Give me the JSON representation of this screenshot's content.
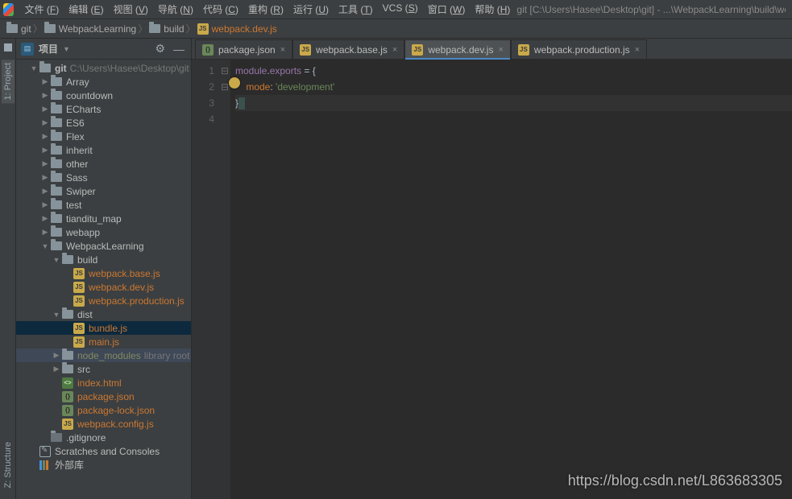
{
  "menu": {
    "items": [
      {
        "label": "文件",
        "u": "F"
      },
      {
        "label": "编辑",
        "u": "E"
      },
      {
        "label": "视图",
        "u": "V"
      },
      {
        "label": "导航",
        "u": "N"
      },
      {
        "label": "代码",
        "u": "C"
      },
      {
        "label": "重构",
        "u": "R"
      },
      {
        "label": "运行",
        "u": "U"
      },
      {
        "label": "工具",
        "u": "T"
      },
      {
        "label": "VCS",
        "u": "S"
      },
      {
        "label": "窗口",
        "u": "W"
      },
      {
        "label": "帮助",
        "u": "H"
      }
    ],
    "title": "git [C:\\Users\\Hasee\\Desktop\\git] - ...\\WebpackLearning\\build\\webpack.dev.js - W"
  },
  "breadcrumb": [
    {
      "type": "folder",
      "label": "git"
    },
    {
      "type": "folder",
      "label": "WebpackLearning"
    },
    {
      "type": "folder",
      "label": "build"
    },
    {
      "type": "js",
      "label": "webpack.dev.js",
      "orange": true
    }
  ],
  "left_tabs": {
    "project": "1: Project",
    "structure": "Z: Structure"
  },
  "tool": {
    "title": "项目",
    "gear_icon": "⚙",
    "min_icon": "—"
  },
  "tree": [
    {
      "depth": 0,
      "arrow": "open",
      "ico": "folder",
      "name": "git",
      "hint": "C:\\Users\\Hasee\\Desktop\\git",
      "bold": true
    },
    {
      "depth": 1,
      "arrow": "closed",
      "ico": "folder",
      "name": "Array"
    },
    {
      "depth": 1,
      "arrow": "closed",
      "ico": "folder",
      "name": "countdown"
    },
    {
      "depth": 1,
      "arrow": "closed",
      "ico": "folder",
      "name": "ECharts"
    },
    {
      "depth": 1,
      "arrow": "closed",
      "ico": "folder",
      "name": "ES6"
    },
    {
      "depth": 1,
      "arrow": "closed",
      "ico": "folder",
      "name": "Flex"
    },
    {
      "depth": 1,
      "arrow": "closed",
      "ico": "folder",
      "name": "inherit"
    },
    {
      "depth": 1,
      "arrow": "closed",
      "ico": "folder",
      "name": "other"
    },
    {
      "depth": 1,
      "arrow": "closed",
      "ico": "folder",
      "name": "Sass"
    },
    {
      "depth": 1,
      "arrow": "closed",
      "ico": "folder",
      "name": "Swiper"
    },
    {
      "depth": 1,
      "arrow": "closed",
      "ico": "folder",
      "name": "test"
    },
    {
      "depth": 1,
      "arrow": "closed",
      "ico": "folder",
      "name": "tianditu_map"
    },
    {
      "depth": 1,
      "arrow": "closed",
      "ico": "folder",
      "name": "webapp"
    },
    {
      "depth": 1,
      "arrow": "open",
      "ico": "folder",
      "name": "WebpackLearning"
    },
    {
      "depth": 2,
      "arrow": "open",
      "ico": "folder",
      "name": "build"
    },
    {
      "depth": 3,
      "arrow": "none",
      "ico": "js",
      "name": "webpack.base.js",
      "orange": true
    },
    {
      "depth": 3,
      "arrow": "none",
      "ico": "js",
      "name": "webpack.dev.js",
      "orange": true
    },
    {
      "depth": 3,
      "arrow": "none",
      "ico": "js",
      "name": "webpack.production.js",
      "orange": true
    },
    {
      "depth": 2,
      "arrow": "open",
      "ico": "folder",
      "name": "dist"
    },
    {
      "depth": 3,
      "arrow": "none",
      "ico": "js",
      "name": "bundle.js",
      "orange": true,
      "sel": true
    },
    {
      "depth": 3,
      "arrow": "none",
      "ico": "js",
      "name": "main.js",
      "orange": true
    },
    {
      "depth": 2,
      "arrow": "closed",
      "ico": "folder",
      "name": "node_modules",
      "muted": true,
      "hint": "library root",
      "sel2": true
    },
    {
      "depth": 2,
      "arrow": "closed",
      "ico": "folder",
      "name": "src"
    },
    {
      "depth": 2,
      "arrow": "none",
      "ico": "html",
      "name": "index.html",
      "orange": true
    },
    {
      "depth": 2,
      "arrow": "none",
      "ico": "json",
      "name": "package.json",
      "orange": true
    },
    {
      "depth": 2,
      "arrow": "none",
      "ico": "json",
      "name": "package-lock.json",
      "orange": true
    },
    {
      "depth": 2,
      "arrow": "none",
      "ico": "js",
      "name": "webpack.config.js",
      "orange": true
    },
    {
      "depth": 1,
      "arrow": "none",
      "ico": "file",
      "name": ".gitignore"
    },
    {
      "depth": 0,
      "arrow": "none",
      "ico": "scratch",
      "name": "Scratches and Consoles"
    },
    {
      "depth": 0,
      "arrow": "none",
      "ico": "lib",
      "name": "外部库"
    }
  ],
  "tabs": [
    {
      "ico": "json",
      "label": "package.json",
      "active": false
    },
    {
      "ico": "js",
      "label": "webpack.base.js",
      "active": false
    },
    {
      "ico": "js",
      "label": "webpack.dev.js",
      "active": true
    },
    {
      "ico": "js",
      "label": "webpack.production.js",
      "active": false
    }
  ],
  "code": {
    "lines": [
      "1",
      "2",
      "3",
      "4"
    ],
    "l1_a": "module",
    "l1_b": ".",
    "l1_c": "exports",
    "l1_d": " = {",
    "l2_a": "    mode",
    "l2_b": ": ",
    "l2_c": "'development'",
    "l3_a": "}"
  },
  "watermark": "https://blog.csdn.net/L863683305"
}
